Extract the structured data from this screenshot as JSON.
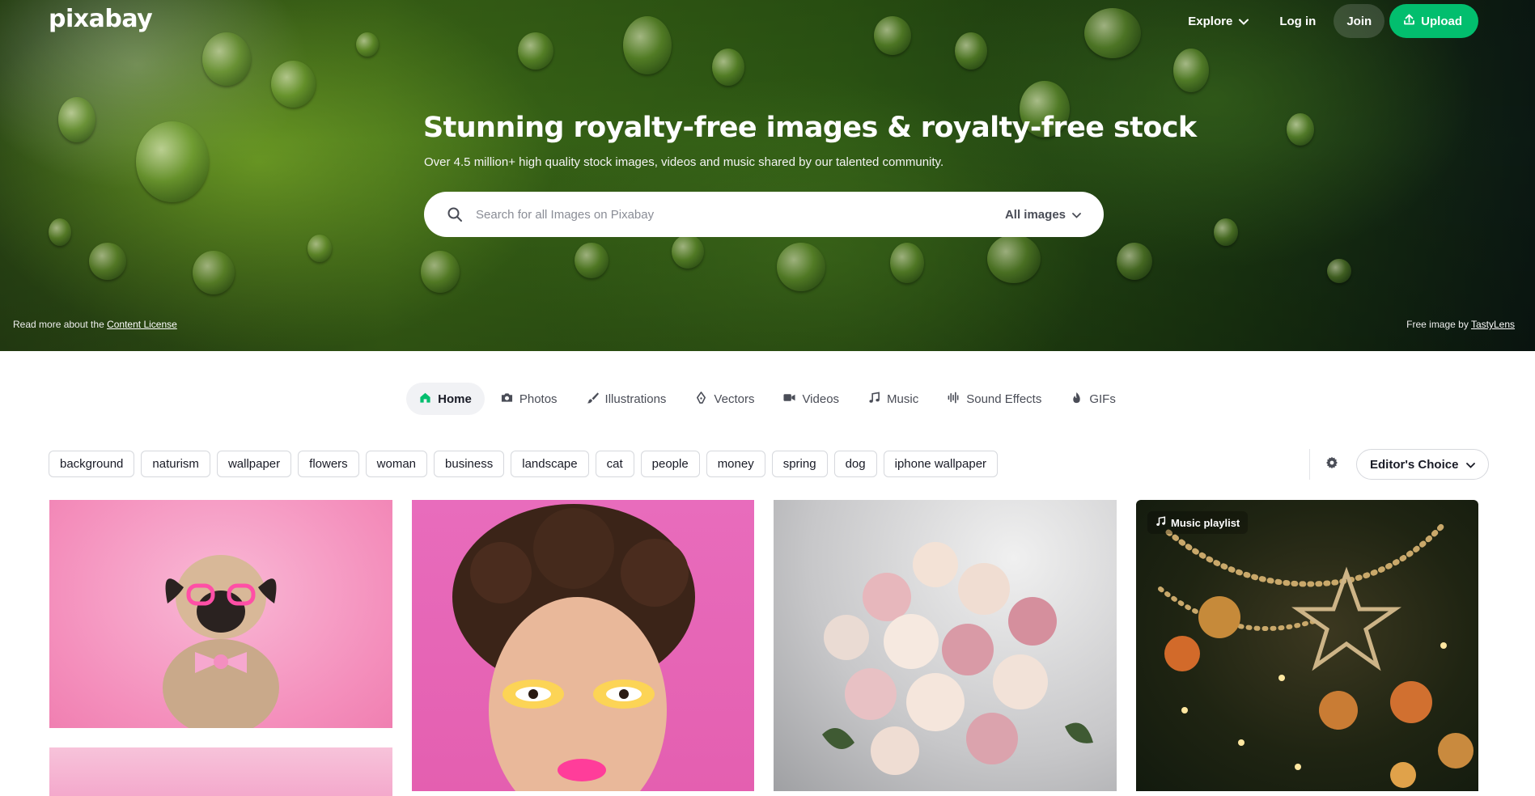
{
  "brand": {
    "logo": "pixabay",
    "accent": "#02be6e"
  },
  "topnav": {
    "explore": "Explore",
    "login": "Log in",
    "join": "Join",
    "upload": "Upload"
  },
  "hero": {
    "title": "Stunning royalty-free images & royalty-free stock",
    "subtitle": "Over 4.5 million+ high quality stock images, videos and music shared by our talented community.",
    "license_prefix": "Read more about the ",
    "license_link": "Content License",
    "credit_prefix": "Free image by ",
    "credit_author": "TastyLens"
  },
  "search": {
    "placeholder": "Search for all Images on Pixabay",
    "value": "",
    "type": "All images"
  },
  "media_tabs": [
    {
      "label": "Home",
      "icon": "home-icon",
      "active": true
    },
    {
      "label": "Photos",
      "icon": "camera-icon"
    },
    {
      "label": "Illustrations",
      "icon": "brush-icon"
    },
    {
      "label": "Vectors",
      "icon": "pen-nib-icon"
    },
    {
      "label": "Videos",
      "icon": "video-icon"
    },
    {
      "label": "Music",
      "icon": "music-note-icon"
    },
    {
      "label": "Sound Effects",
      "icon": "waveform-icon"
    },
    {
      "label": "GIFs",
      "icon": "flame-icon"
    }
  ],
  "chips": [
    "background",
    "naturism",
    "wallpaper",
    "flowers",
    "woman",
    "business",
    "landscape",
    "cat",
    "people",
    "money",
    "spring",
    "dog",
    "iphone wallpaper"
  ],
  "filters": {
    "sort": "Editor's Choice"
  },
  "grid": {
    "playlist_badge": "Music playlist"
  }
}
